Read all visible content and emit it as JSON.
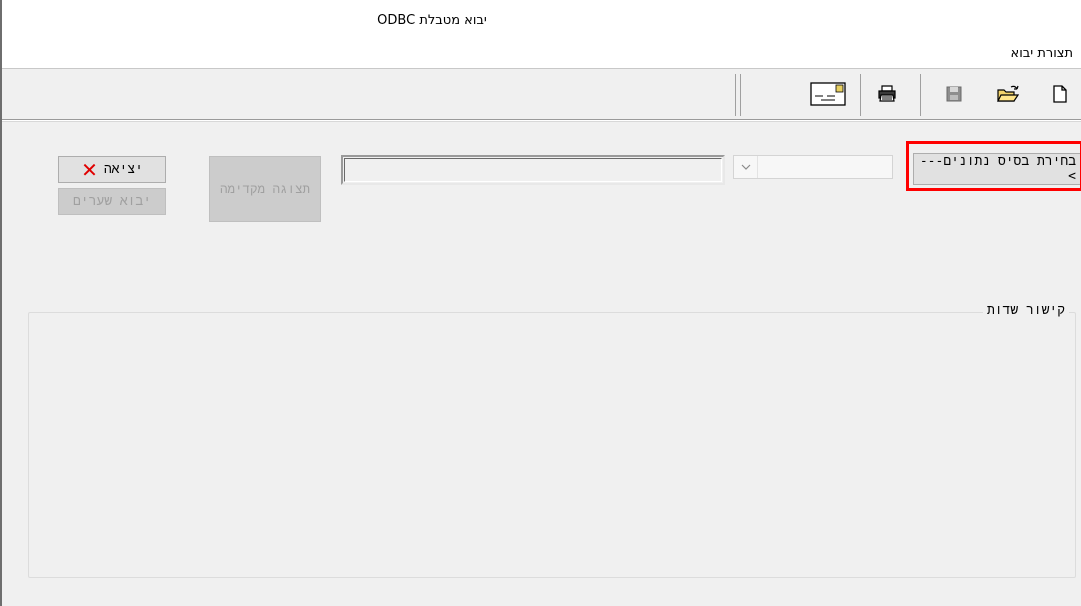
{
  "window": {
    "title": "יבוא מטבלת ODBC"
  },
  "menu": {
    "items": [
      "תצורת יבוא"
    ]
  },
  "toolbar": {
    "buttons": [
      "new-file-icon",
      "open-folder-icon",
      "save-icon",
      "print-icon",
      "envelope-icon"
    ]
  },
  "form": {
    "select_db_label": "בחירת בסיס נתונים--->",
    "db_combo_value": "",
    "table_value": "",
    "preview_label": "תצוגה מקדימה",
    "exit_label": "יציאה",
    "import_gates_label": "יבוא שערים",
    "field_mapping_label": "קישור שדות"
  },
  "colors": {
    "highlight": "#ff0000",
    "exit_icon": "#e00000"
  }
}
